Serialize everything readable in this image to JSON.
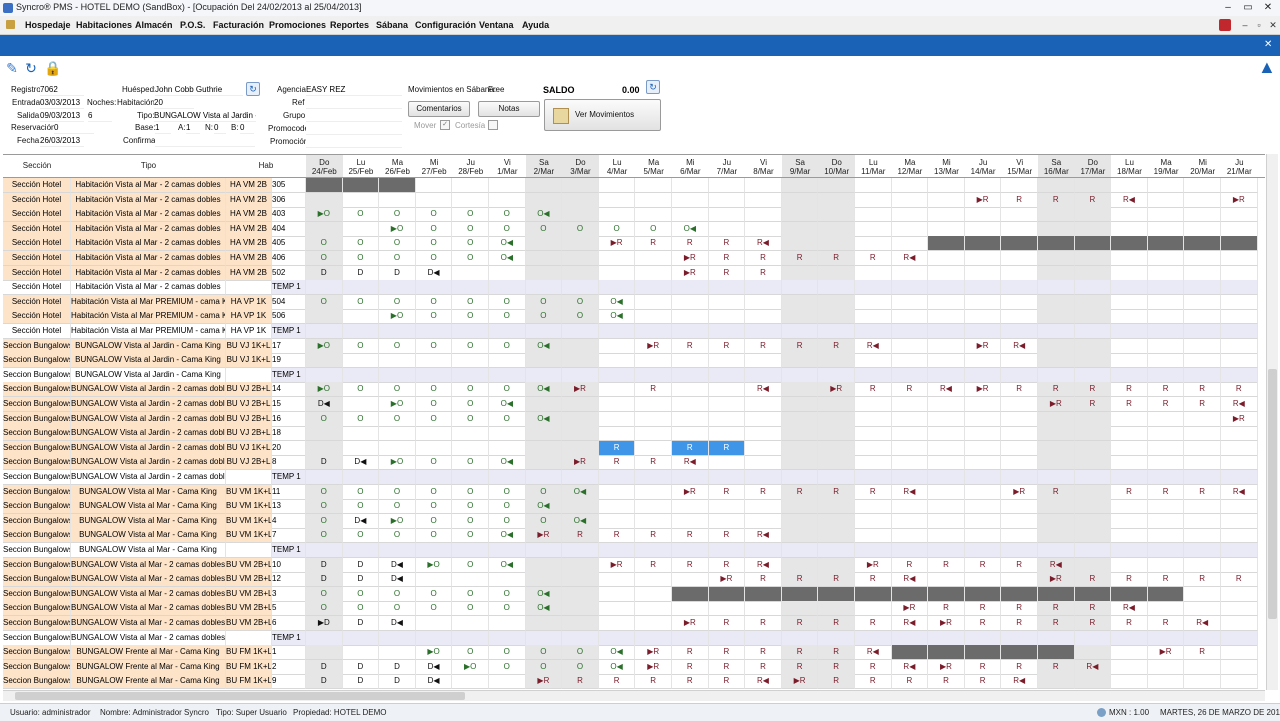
{
  "window": {
    "title": "Syncro® PMS - HOTEL DEMO (SandBox) - [Ocupación Del 24/02/2013 al 25/04/2013]"
  },
  "menu": [
    "Hospedaje",
    "Habitaciones",
    "Almacén",
    "P.O.S.",
    "Facturación",
    "Promociones",
    "Reportes",
    "Sábana",
    "Configuración",
    "Ventana",
    "Ayuda"
  ],
  "info": {
    "registro_label": "Registro:",
    "registro": "7062",
    "entrada_label": "Entrada:",
    "entrada": "03/03/2013",
    "noches_label": "Noches:",
    "noches": "6",
    "salida_label": "Salida:",
    "salida": "09/03/2013",
    "reservacion_label": "Reservación:",
    "reservacion": "0",
    "fecha_label": "Fecha:",
    "fecha": "26/03/2013",
    "huesped_label": "Huésped:",
    "huesped": "John Cobb Guthrie",
    "habitacion_label": "Habitación:",
    "habitacion": "20",
    "tipo_label": "Tipo:",
    "tipo": "BUNGALOW Vista al Jardin - 2",
    "base_label": "Base:",
    "base": "1",
    "a_label": "A:",
    "a": "1",
    "n_label": "N:",
    "n": "0",
    "b_label": "B:",
    "b": "0",
    "confirma_label": "Confirma:",
    "agencia_label": "Agencia:",
    "agencia": "EASY REZ",
    "ref_label": "Ref",
    "grupo_label": "Grupo:",
    "promocode_label": "Promocode:",
    "promocion_label": "Promoción:",
    "movimientos_label": "Movimientos en Sábana:",
    "movimientos": "Free",
    "saldo_label": "SALDO",
    "saldo": "0.00"
  },
  "buttons": {
    "comentarios": "Comentarios",
    "notas": "Notas",
    "ver_movimientos": "Ver Movimientos",
    "mover": "Mover",
    "cortesia": "Cortesía"
  },
  "grid": {
    "headers": {
      "seccion": "Sección",
      "tipo": "Tipo",
      "hab": "Hab"
    },
    "dates": [
      [
        "Do",
        "24/Feb"
      ],
      [
        "Lu",
        "25/Feb"
      ],
      [
        "Ma",
        "26/Feb"
      ],
      [
        "Mi",
        "27/Feb"
      ],
      [
        "Ju",
        "28/Feb"
      ],
      [
        "Vi",
        "1/Mar"
      ],
      [
        "Sa",
        "2/Mar"
      ],
      [
        "Do",
        "3/Mar"
      ],
      [
        "Lu",
        "4/Mar"
      ],
      [
        "Ma",
        "5/Mar"
      ],
      [
        "Mi",
        "6/Mar"
      ],
      [
        "Ju",
        "7/Mar"
      ],
      [
        "Vi",
        "8/Mar"
      ],
      [
        "Sa",
        "9/Mar"
      ],
      [
        "Do",
        "10/Mar"
      ],
      [
        "Lu",
        "11/Mar"
      ],
      [
        "Ma",
        "12/Mar"
      ],
      [
        "Mi",
        "13/Mar"
      ],
      [
        "Ju",
        "14/Mar"
      ],
      [
        "Vi",
        "15/Mar"
      ],
      [
        "Sa",
        "16/Mar"
      ],
      [
        "Do",
        "17/Mar"
      ],
      [
        "Lu",
        "18/Mar"
      ],
      [
        "Ma",
        "19/Mar"
      ],
      [
        "Mi",
        "20/Mar"
      ],
      [
        "Ju",
        "21/Mar"
      ]
    ],
    "weekend_cols": [
      0,
      6,
      7,
      13,
      14,
      20,
      21
    ],
    "rows": [
      {
        "s": "Sección Hotel",
        "t": "Habitación Vista al Mar - 2 camas dobles",
        "code": "HA VM 2B",
        "hab": "305",
        "cells": {},
        "blk": [
          [
            0,
            3
          ]
        ]
      },
      {
        "s": "Sección Hotel",
        "t": "Habitación Vista al Mar - 2 camas dobles",
        "code": "HA VM 2B",
        "hab": "306",
        "cells": {
          "18": "▶R",
          "19": "R",
          "20": "R",
          "21": "R",
          "22": "R◀",
          "25": "▶R"
        }
      },
      {
        "s": "Sección Hotel",
        "t": "Habitación Vista al Mar - 2 camas dobles",
        "code": "HA VM 2B",
        "hab": "403",
        "cells": {
          "0": "▶O",
          "1": "O",
          "2": "O",
          "3": "O",
          "4": "O",
          "5": "O",
          "6": "O◀"
        }
      },
      {
        "s": "Sección Hotel",
        "t": "Habitación Vista al Mar - 2 camas dobles",
        "code": "HA VM 2B",
        "hab": "404",
        "cells": {
          "2": "▶O",
          "3": "O",
          "4": "O",
          "5": "O",
          "6": "O",
          "7": "O",
          "8": "O",
          "9": "O",
          "10": "O◀"
        }
      },
      {
        "s": "Sección Hotel",
        "t": "Habitación Vista al Mar - 2 camas dobles",
        "code": "HA VM 2B",
        "hab": "405",
        "cells": {
          "0": "O",
          "1": "O",
          "2": "O",
          "3": "O",
          "4": "O",
          "5": "O◀",
          "8": "▶R",
          "9": "R",
          "10": "R",
          "11": "R",
          "12": "R◀"
        },
        "blk": [
          [
            17,
            26
          ]
        ]
      },
      {
        "s": "Sección Hotel",
        "t": "Habitación Vista al Mar - 2 camas dobles",
        "code": "HA VM 2B",
        "hab": "406",
        "cells": {
          "0": "O",
          "1": "O",
          "2": "O",
          "3": "O",
          "4": "O",
          "5": "O◀",
          "10": "▶R",
          "11": "R",
          "12": "R",
          "13": "R",
          "14": "R",
          "15": "R",
          "16": "R◀"
        }
      },
      {
        "s": "Sección Hotel",
        "t": "Habitación Vista al Mar - 2 camas dobles",
        "code": "HA VM 2B",
        "hab": "502",
        "cells": {
          "0": "D",
          "1": "D",
          "2": "D",
          "3": "D◀",
          "10": "▶R",
          "11": "R",
          "12": "R"
        }
      },
      {
        "s": "Sección Hotel",
        "t": "Habitación Vista al Mar - 2 camas dobles",
        "code": "",
        "hab": "TEMP 1",
        "temp": true,
        "cells": {}
      },
      {
        "s": "Sección Hotel",
        "t": "Habitación Vista al Mar PREMIUM - cama King",
        "code": "HA VP 1K",
        "hab": "504",
        "cells": {
          "0": "O",
          "1": "O",
          "2": "O",
          "3": "O",
          "4": "O",
          "5": "O",
          "6": "O",
          "7": "O",
          "8": "O◀"
        }
      },
      {
        "s": "Sección Hotel",
        "t": "Habitación Vista al Mar PREMIUM - cama King",
        "code": "HA VP 1K",
        "hab": "506",
        "cells": {
          "2": "▶O",
          "3": "O",
          "4": "O",
          "5": "O",
          "6": "O",
          "7": "O",
          "8": "O◀"
        }
      },
      {
        "s": "Sección Hotel",
        "t": "Habitación Vista al Mar PREMIUM - cama King",
        "code": "HA VP 1K",
        "hab": "TEMP 1",
        "temp": true,
        "cells": {}
      },
      {
        "s": "Seccion Bungalows",
        "t": "BUNGALOW Vista al Jardin - Cama King",
        "code": "BU VJ 1K+L",
        "hab": "17",
        "cells": {
          "0": "▶O",
          "1": "O",
          "2": "O",
          "3": "O",
          "4": "O",
          "5": "O",
          "6": "O◀",
          "9": "▶R",
          "10": "R",
          "11": "R",
          "12": "R",
          "13": "R",
          "14": "R",
          "15": "R◀",
          "18": "▶R",
          "19": "R◀"
        }
      },
      {
        "s": "Seccion Bungalows",
        "t": "BUNGALOW Vista al Jardin - Cama King",
        "code": "BU VJ 1K+L",
        "hab": "19",
        "cells": {}
      },
      {
        "s": "Seccion Bungalows",
        "t": "BUNGALOW Vista al Jardin - Cama King",
        "code": "",
        "hab": "TEMP 1",
        "temp": true,
        "cells": {}
      },
      {
        "s": "Seccion Bungalows",
        "t": "BUNGALOW Vista al Jardin - 2 camas dobles",
        "code": "BU VJ 2B+L",
        "hab": "14",
        "cells": {
          "0": "▶O",
          "1": "O",
          "2": "O",
          "3": "O",
          "4": "O",
          "5": "O",
          "6": "O◀",
          "7": "▶R",
          "9": "R",
          "12": "R◀",
          "14": "▶R",
          "15": "R",
          "16": "R",
          "17": "R◀",
          "18": "▶R",
          "19": "R",
          "20": "R",
          "21": "R",
          "22": "R",
          "23": "R",
          "24": "R",
          "25": "R"
        }
      },
      {
        "s": "Seccion Bungalows",
        "t": "BUNGALOW Vista al Jardin - 2 camas dobles",
        "code": "BU VJ 2B+L",
        "hab": "15",
        "cells": {
          "0": "D◀",
          "2": "▶O",
          "3": "O",
          "4": "O",
          "5": "O◀",
          "20": "▶R",
          "21": "R",
          "22": "R",
          "23": "R",
          "24": "R",
          "25": "R◀"
        }
      },
      {
        "s": "Seccion Bungalows",
        "t": "BUNGALOW Vista al Jardin - 2 camas dobles",
        "code": "BU VJ 2B+L",
        "hab": "16",
        "cells": {
          "0": "O",
          "1": "O",
          "2": "O",
          "3": "O",
          "4": "O",
          "5": "O",
          "6": "O◀",
          "25": "▶R"
        }
      },
      {
        "s": "Seccion Bungalows",
        "t": "BUNGALOW Vista al Jardin - 2 camas dobles",
        "code": "BU VJ 2B+L",
        "hab": "18",
        "cells": {}
      },
      {
        "s": "Seccion Bungalows",
        "t": "BUNGALOW Vista al Jardin - 2 camas dobles",
        "code": "BU VJ 1K+L",
        "hab": "20",
        "cells": {
          "8": "R",
          "10": "R",
          "11": "R"
        },
        "sel": [
          8,
          10,
          11
        ]
      },
      {
        "s": "Seccion Bungalows",
        "t": "BUNGALOW Vista al Jardin - 2 camas dobles",
        "code": "BU VJ 2B+L",
        "hab": "8",
        "cells": {
          "0": "D",
          "1": "D◀",
          "2": "▶O",
          "3": "O",
          "4": "O",
          "5": "O◀",
          "7": "▶R",
          "8": "R",
          "9": "R",
          "10": "R◀"
        }
      },
      {
        "s": "Seccion Bungalows",
        "t": "BUNGALOW Vista al Jardin - 2 camas dobles",
        "code": "",
        "hab": "TEMP 1",
        "temp": true,
        "cells": {}
      },
      {
        "s": "Seccion Bungalows",
        "t": "BUNGALOW Vista al Mar - Cama King",
        "code": "BU VM 1K+L",
        "hab": "11",
        "cells": {
          "0": "O",
          "1": "O",
          "2": "O",
          "3": "O",
          "4": "O",
          "5": "O",
          "6": "O",
          "7": "O◀",
          "10": "▶R",
          "11": "R",
          "12": "R",
          "13": "R",
          "14": "R",
          "15": "R",
          "16": "R◀",
          "19": "▶R",
          "20": "R",
          "22": "R",
          "23": "R",
          "24": "R",
          "25": "R◀"
        }
      },
      {
        "s": "Seccion Bungalows",
        "t": "BUNGALOW Vista al Mar - Cama King",
        "code": "BU VM 1K+L",
        "hab": "13",
        "cells": {
          "0": "O",
          "1": "O",
          "2": "O",
          "3": "O",
          "4": "O",
          "5": "O",
          "6": "O◀"
        }
      },
      {
        "s": "Seccion Bungalows",
        "t": "BUNGALOW Vista al Mar - Cama King",
        "code": "BU VM 1K+L",
        "hab": "4",
        "cells": {
          "0": "O",
          "1": "D◀",
          "2": "▶O",
          "3": "O",
          "4": "O",
          "5": "O",
          "6": "O",
          "7": "O◀"
        }
      },
      {
        "s": "Seccion Bungalows",
        "t": "BUNGALOW Vista al Mar - Cama King",
        "code": "BU VM 1K+L",
        "hab": "7",
        "cells": {
          "0": "O",
          "1": "O",
          "2": "O",
          "3": "O",
          "4": "O",
          "5": "O◀",
          "6": "▶R",
          "7": "R",
          "8": "R",
          "9": "R",
          "10": "R",
          "11": "R",
          "12": "R◀"
        }
      },
      {
        "s": "Seccion Bungalows",
        "t": "BUNGALOW Vista al Mar - Cama King",
        "code": "",
        "hab": "TEMP 1",
        "temp": true,
        "cells": {}
      },
      {
        "s": "Seccion Bungalows",
        "t": "BUNGALOW Vista al Mar - 2 camas dobles",
        "code": "BU VM 2B+L",
        "hab": "10",
        "cells": {
          "0": "D",
          "1": "D",
          "2": "D◀",
          "3": "▶O",
          "4": "O",
          "5": "O◀",
          "8": "▶R",
          "9": "R",
          "10": "R",
          "11": "R",
          "12": "R◀",
          "15": "▶R",
          "16": "R",
          "17": "R",
          "18": "R",
          "19": "R",
          "20": "R◀"
        }
      },
      {
        "s": "Seccion Bungalows",
        "t": "BUNGALOW Vista al Mar - 2 camas dobles",
        "code": "BU VM 2B+L",
        "hab": "12",
        "cells": {
          "0": "D",
          "1": "D",
          "2": "D◀",
          "11": "▶R",
          "12": "R",
          "13": "R",
          "14": "R",
          "15": "R",
          "16": "R◀",
          "20": "▶R",
          "21": "R",
          "22": "R",
          "23": "R",
          "24": "R",
          "25": "R"
        }
      },
      {
        "s": "Seccion Bungalows",
        "t": "BUNGALOW Vista al Mar - 2 camas dobles",
        "code": "BU VM 2B+L",
        "hab": "3",
        "cells": {
          "0": "O",
          "1": "O",
          "2": "O",
          "3": "O",
          "4": "O",
          "5": "O",
          "6": "O◀"
        },
        "blk": [
          [
            10,
            24
          ]
        ]
      },
      {
        "s": "Seccion Bungalows",
        "t": "BUNGALOW Vista al Mar - 2 camas dobles",
        "code": "BU VM 2B+L",
        "hab": "5",
        "cells": {
          "0": "O",
          "1": "O",
          "2": "O",
          "3": "O",
          "4": "O",
          "5": "O",
          "6": "O◀",
          "16": "▶R",
          "17": "R",
          "18": "R",
          "19": "R",
          "20": "R",
          "21": "R",
          "22": "R◀"
        }
      },
      {
        "s": "Seccion Bungalows",
        "t": "BUNGALOW Vista al Mar - 2 camas dobles",
        "code": "BU VM 2B+L",
        "hab": "6",
        "cells": {
          "0": "▶D",
          "1": "D",
          "2": "D◀",
          "10": "▶R",
          "11": "R",
          "12": "R",
          "13": "R",
          "14": "R",
          "15": "R",
          "16": "R◀",
          "17": "▶R",
          "18": "R",
          "19": "R",
          "20": "R",
          "21": "R",
          "22": "R",
          "23": "R",
          "24": "R◀"
        }
      },
      {
        "s": "Seccion Bungalows",
        "t": "BUNGALOW Vista al Mar - 2 camas dobles",
        "code": "",
        "hab": "TEMP 1",
        "temp": true,
        "cells": {}
      },
      {
        "s": "Seccion Bungalows",
        "t": "BUNGALOW Frente al Mar - Cama King",
        "code": "BU FM 1K+L",
        "hab": "1",
        "cells": {
          "3": "▶O",
          "4": "O",
          "5": "O",
          "6": "O",
          "7": "O",
          "8": "O◀",
          "9": "▶R",
          "10": "R",
          "11": "R",
          "12": "R",
          "13": "R",
          "14": "R",
          "15": "R◀",
          "23": "▶R",
          "24": "R"
        },
        "blk": [
          [
            16,
            21
          ]
        ]
      },
      {
        "s": "Seccion Bungalows",
        "t": "BUNGALOW Frente al Mar - Cama King",
        "code": "BU FM 1K+L",
        "hab": "2",
        "cells": {
          "0": "D",
          "1": "D",
          "2": "D",
          "3": "D◀",
          "4": "▶O",
          "5": "O",
          "6": "O",
          "7": "O",
          "8": "O◀",
          "9": "▶R",
          "10": "R",
          "11": "R",
          "12": "R",
          "13": "R",
          "14": "R",
          "15": "R",
          "16": "R◀",
          "17": "▶R",
          "18": "R",
          "19": "R",
          "20": "R",
          "21": "R◀"
        }
      },
      {
        "s": "Seccion Bungalows",
        "t": "BUNGALOW Frente al Mar - Cama King",
        "code": "BU FM 1K+L",
        "hab": "9",
        "cells": {
          "0": "D",
          "1": "D",
          "2": "D",
          "3": "D◀",
          "6": "▶R",
          "7": "R",
          "8": "R",
          "9": "R",
          "10": "R",
          "11": "R",
          "12": "R◀",
          "13": "▶R",
          "14": "R",
          "15": "R",
          "16": "R",
          "17": "R",
          "18": "R",
          "19": "R◀"
        }
      }
    ]
  },
  "status": {
    "usuario": "Usuario: administrador",
    "nombre": "Nombre: Administrador Syncro",
    "tipo": "Tipo: Super Usuario",
    "propiedad": "Propiedad: HOTEL DEMO",
    "currency": "MXN : 1.00",
    "date": "MARTES, 26 DE MARZO DE 2013"
  },
  "icons": {
    "edit": "pencil-icon",
    "refresh": "refresh-icon",
    "lock": "lock-icon",
    "up": "up-arrow-icon"
  }
}
